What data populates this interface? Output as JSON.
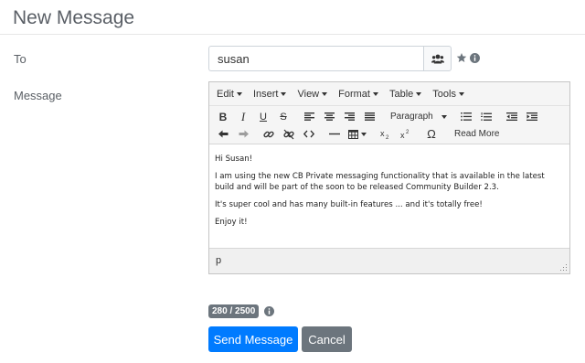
{
  "page": {
    "title": "New Message"
  },
  "form": {
    "to_label": "To",
    "message_label": "Message",
    "to_value": "susan"
  },
  "editor": {
    "menus": [
      "Edit",
      "Insert",
      "View",
      "Format",
      "Table",
      "Tools"
    ],
    "toolbar": {
      "bold": "B",
      "italic": "I",
      "underline": "U",
      "strike": "S",
      "paragraph_format": "Paragraph",
      "read_more": "Read More",
      "omega": "Ω"
    },
    "content": [
      "Hi Susan!",
      "I am using the new CB Private messaging functionality that is available in the latest build and will be part of the soon to be released Community Builder 2.3.",
      "It's super cool and has many built-in features ... and it's totally free!",
      "Enjoy it!"
    ],
    "status_path": "p"
  },
  "counter": {
    "text": "280 / 2500"
  },
  "actions": {
    "send_label": "Send Message",
    "cancel_label": "Cancel"
  },
  "colors": {
    "primary": "#007bff",
    "secondary": "#6c757d"
  }
}
